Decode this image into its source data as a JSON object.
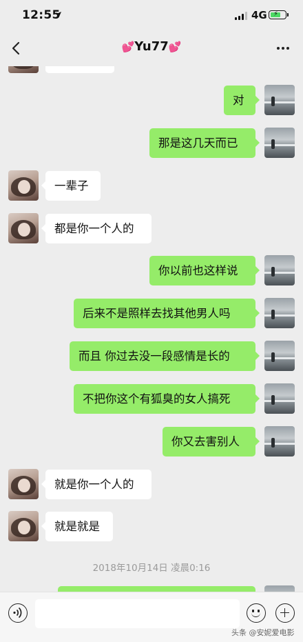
{
  "status_bar": {
    "time": "12:55",
    "network": "4G",
    "battery_level": 0.7
  },
  "nav": {
    "title": "Yu77",
    "title_decoration_icon": "heart-icon"
  },
  "messages": [
    {
      "side": "in",
      "text": ""
    },
    {
      "side": "out",
      "text": "对"
    },
    {
      "side": "out",
      "text": "那是这几天而已"
    },
    {
      "side": "in",
      "text": "一辈子"
    },
    {
      "side": "in",
      "text": "都是你一个人的"
    },
    {
      "side": "out",
      "text": "你以前也这样说"
    },
    {
      "side": "out",
      "text": "后来不是照样去找其他男人吗"
    },
    {
      "side": "out",
      "text": "而且 你过去没一段感情是长的"
    },
    {
      "side": "out",
      "text": "不把你这个有狐臭的女人搞死"
    },
    {
      "side": "out",
      "text": "你又去害别人"
    },
    {
      "side": "in",
      "text": "就是你一个人的"
    },
    {
      "side": "in",
      "text": "就是就是"
    },
    {
      "side": "out",
      "text": ""
    }
  ],
  "timestamp": "2018年10月14日 凌晨0:16",
  "input": {
    "value": "",
    "placeholder": ""
  },
  "watermark": "头条 @安妮爱电影",
  "colors": {
    "background": "#ededed",
    "outgoing_bubble": "#95ec69",
    "incoming_bubble": "#ffffff"
  }
}
